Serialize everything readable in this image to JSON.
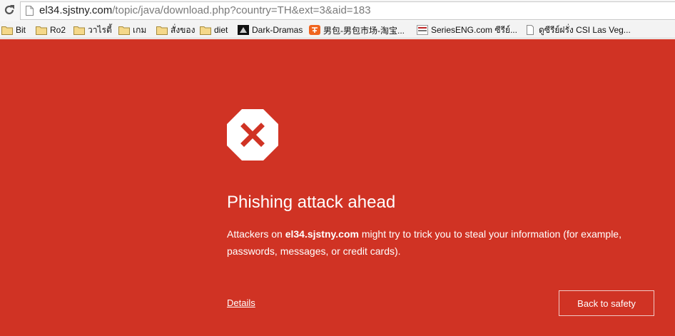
{
  "browser": {
    "url_host": "el34.sjstny.com",
    "url_path": "/topic/java/download.php?country=TH&ext=3&aid=183"
  },
  "bookmarks": [
    {
      "label": "Bit",
      "icon": "folder-icon"
    },
    {
      "label": "Ro2",
      "icon": "folder-icon"
    },
    {
      "label": "วาไรตี้",
      "icon": "folder-icon"
    },
    {
      "label": "เกม",
      "icon": "folder-icon"
    },
    {
      "label": "สั่งของ",
      "icon": "folder-icon"
    },
    {
      "label": "diet",
      "icon": "folder-icon"
    },
    {
      "label": "Dark-Dramas",
      "icon": "site-favicon"
    },
    {
      "label": "男包-男包市场-淘宝...",
      "icon": "taobao-favicon"
    },
    {
      "label": "SeriesENG.com ซีรีย์...",
      "icon": "site-favicon"
    },
    {
      "label": "ดูซีรีย์ฝรั่ง CSI Las Veg...",
      "icon": "page-icon"
    }
  ],
  "warning": {
    "title": "Phishing attack ahead",
    "message_prefix": "Attackers on ",
    "site": "el34.sjstny.com",
    "message_suffix": " might try to trick you to steal your information (for example, passwords, messages, or credit cards).",
    "details_label": "Details",
    "back_label": "Back to safety",
    "background_color": "#d03324"
  }
}
